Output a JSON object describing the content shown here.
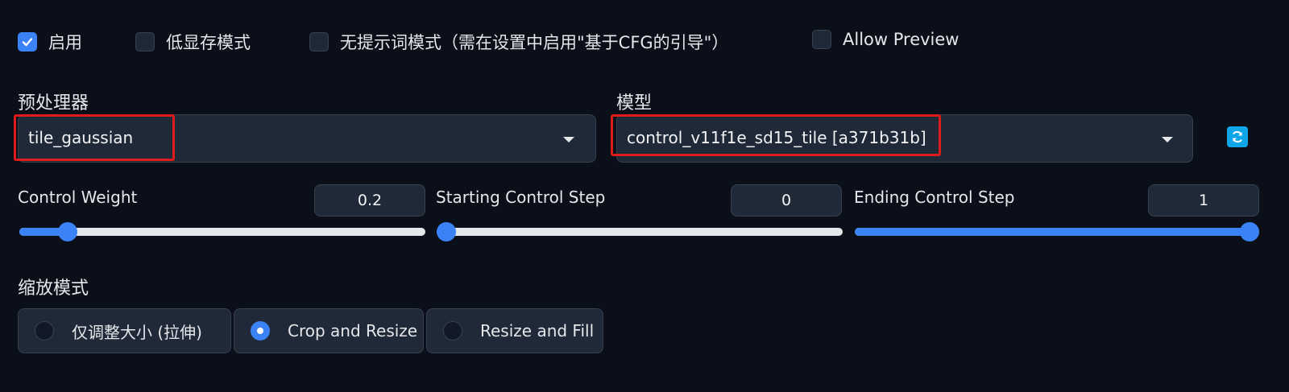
{
  "checkboxes": [
    {
      "label": "启用",
      "checked": true
    },
    {
      "label": "低显存模式",
      "checked": false
    },
    {
      "label": "无提示词模式（需在设置中启用\"基于CFG的引导\"）",
      "checked": false
    },
    {
      "label": "Allow Preview",
      "checked": false
    }
  ],
  "preprocessor": {
    "label": "预处理器",
    "value": "tile_gaussian"
  },
  "model": {
    "label": "模型",
    "value": "control_v11f1e_sd15_tile [a371b31b]"
  },
  "refresh_icon": "refresh-icon",
  "sliders": [
    {
      "label": "Control Weight",
      "value": "0.2",
      "fraction": 0.1
    },
    {
      "label": "Starting Control Step",
      "value": "0",
      "fraction": 0.0
    },
    {
      "label": "Ending Control Step",
      "value": "1",
      "fraction": 1.0
    }
  ],
  "resize_mode": {
    "label": "缩放模式",
    "options": [
      {
        "label": "仅调整大小 (拉伸)",
        "selected": false
      },
      {
        "label": "Crop and Resize",
        "selected": true
      },
      {
        "label": "Resize and Fill",
        "selected": false
      }
    ]
  },
  "colors": {
    "accent": "#3b82f6",
    "highlight": "#e01b1b",
    "background": "#0b0f19"
  }
}
